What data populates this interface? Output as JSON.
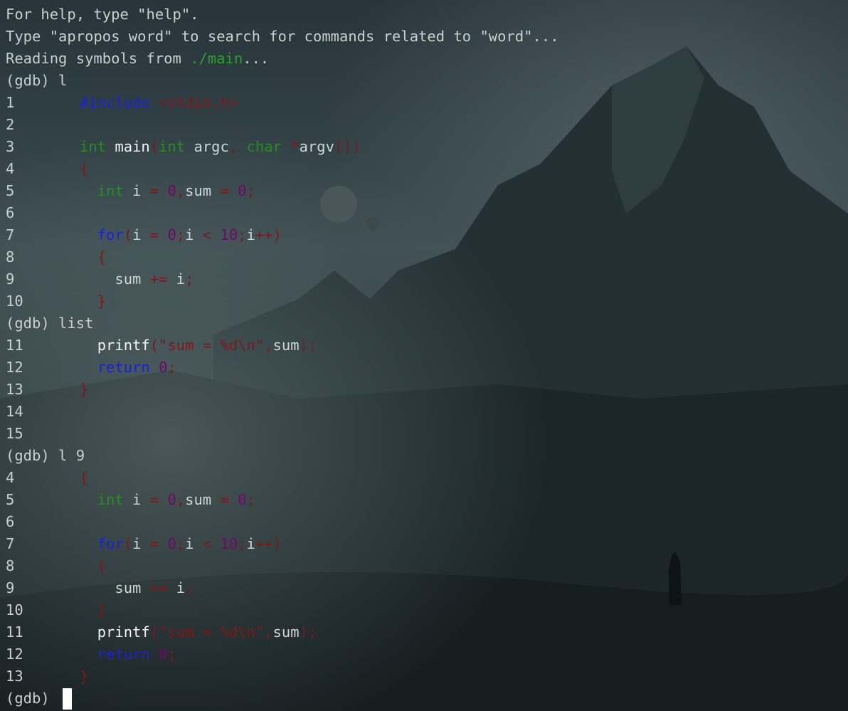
{
  "colors": {
    "text": "#c9cfcf",
    "keyword": "#2a8a24",
    "directive": "#1a22d4",
    "punct": "#7a1a1a",
    "number": "#6e0a66",
    "path": "#2aa02a",
    "cursor": "#ffffff"
  },
  "intro": {
    "help": "For help, type \"help\".",
    "apropos": "Type \"apropos word\" to search for commands related to \"word\"...",
    "reading_prefix": "Reading symbols from ",
    "reading_path": "./main",
    "reading_suffix": "..."
  },
  "commands": {
    "list_short": "(gdb) l",
    "list_long": "(gdb) list",
    "list_line": "(gdb) l 9",
    "prompt": "(gdb) "
  },
  "source": {
    "l1": {
      "num": "1",
      "a": "#include",
      "b": " ",
      "c": "<stdio.h>"
    },
    "l2": {
      "num": "2"
    },
    "l3": {
      "num": "3",
      "a": "int",
      "b": " ",
      "c": "main",
      "d": "(",
      "e": "int",
      "f": " argc",
      "g": ",",
      "h": " ",
      "i": "char",
      "j": " ",
      "k": "*",
      "l": "argv",
      "m": "[])"
    },
    "l4": {
      "num": "4",
      "a": "{"
    },
    "l5": {
      "num": "5",
      "a": "  ",
      "b": "int",
      "c": " i ",
      "d": "=",
      "e": " ",
      "f": "0",
      "g": ",",
      "h": "sum ",
      "i": "=",
      "j": " ",
      "k": "0",
      "l": ";"
    },
    "l6": {
      "num": "6"
    },
    "l7": {
      "num": "7",
      "a": "  ",
      "b": "for",
      "c": "(",
      "d": "i ",
      "e": "=",
      "f": " ",
      "g": "0",
      "h": ";",
      "i": "i ",
      "j": "<",
      "k": " ",
      "l": "10",
      "m": ";",
      "n": "i",
      "o": "++)"
    },
    "l8": {
      "num": "8",
      "a": "  ",
      "b": "{"
    },
    "l9": {
      "num": "9",
      "a": "    ",
      "b": "sum ",
      "c": "+=",
      "d": " i",
      "e": ";"
    },
    "l10": {
      "num": "10",
      "a": "  ",
      "b": "}"
    },
    "l11": {
      "num": "11",
      "a": "  ",
      "b": "printf",
      "c": "(\"sum = %d\\n\"",
      "d": ",",
      "e": "sum",
      "f": ");"
    },
    "l12": {
      "num": "12",
      "a": "  ",
      "b": "return",
      "c": " ",
      "d": "0",
      "e": ";"
    },
    "l13": {
      "num": "13",
      "a": "}"
    },
    "l14": {
      "num": "14"
    },
    "l15": {
      "num": "15"
    }
  }
}
